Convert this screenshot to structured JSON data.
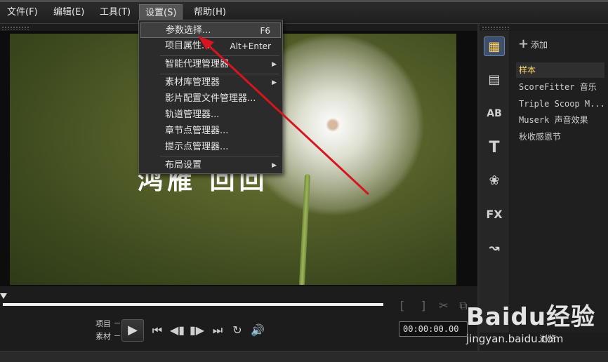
{
  "menubar": {
    "items": [
      "文件(F)",
      "编辑(E)",
      "工具(T)",
      "设置(S)",
      "帮助(H)"
    ]
  },
  "settings_menu": {
    "items": [
      {
        "label": "参数选择...",
        "shortcut": "F6"
      },
      {
        "label": "项目属性...",
        "shortcut": "Alt+Enter"
      },
      {
        "label": "智能代理管理器"
      },
      {
        "label": "素材库管理器"
      },
      {
        "label": "影片配置文件管理器..."
      },
      {
        "label": "轨道管理器..."
      },
      {
        "label": "章节点管理器..."
      },
      {
        "label": "提示点管理器..."
      },
      {
        "label": "布局设置"
      }
    ]
  },
  "preview": {
    "overlay_text": "鸿雁 回回",
    "mode_project": "项目",
    "mode_clip": "素材",
    "timecode": "00:00:00.00"
  },
  "library": {
    "add_label": "添加",
    "items": [
      "样本",
      "ScoreFitter 音乐",
      "Triple Scoop M...",
      "Muserk 声音效果",
      "秋收感恩节"
    ],
    "browse_label": "浏览"
  },
  "toolbar_icons": [
    "media-icon",
    "transition-icon",
    "title-ab-icon",
    "text-icon",
    "graphic-icon",
    "fx-icon",
    "path-icon"
  ],
  "watermark": {
    "brand": "Baidu经验",
    "url": "jingyan.baidu.com"
  },
  "colors": {
    "annotation_arrow": "#d9141e",
    "selected_item": "#ffd96a"
  }
}
